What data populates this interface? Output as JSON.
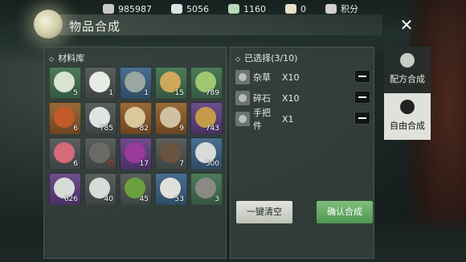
{
  "resources": [
    {
      "name": "currency-1",
      "value": "985987",
      "color": "#c9c9c9"
    },
    {
      "name": "currency-2",
      "value": "5056",
      "color": "#d8e4e8"
    },
    {
      "name": "currency-3",
      "value": "1160",
      "color": "#b8d8b8"
    },
    {
      "name": "currency-4",
      "value": "0",
      "color": "#e8e0c8"
    },
    {
      "name": "points",
      "value": "积分",
      "color": "#d0d0d0"
    }
  ],
  "header": {
    "title": "物品合成",
    "close": "✕"
  },
  "materials": {
    "title": "材料库",
    "items": [
      {
        "q": "green",
        "glyph": "#d8e4d0",
        "count": "5"
      },
      {
        "q": "gray",
        "glyph": "#e8ece6",
        "count": "1"
      },
      {
        "q": "blue",
        "glyph": "#9aa6a2",
        "count": "1"
      },
      {
        "q": "green",
        "glyph": "#d0a85a",
        "count": "15"
      },
      {
        "q": "green",
        "glyph": "#a0c870",
        "count": "789"
      },
      {
        "q": "orange",
        "glyph": "#c25a2a",
        "count": "6"
      },
      {
        "q": "gray",
        "glyph": "#e0e4e0",
        "count": "785"
      },
      {
        "q": "orange",
        "glyph": "#d8c89a",
        "count": "82"
      },
      {
        "q": "orange",
        "glyph": "#cfc2a2",
        "count": "9"
      },
      {
        "q": "purple",
        "glyph": "#c49a4a",
        "count": "743"
      },
      {
        "q": "gray",
        "glyph": "#d46a7a",
        "count": "6"
      },
      {
        "q": "gray",
        "glyph": "#6a6a66",
        "count": "0",
        "red": true
      },
      {
        "q": "purple",
        "glyph": "#9a3a9a",
        "count": "17"
      },
      {
        "q": "gray",
        "glyph": "#6a5440",
        "count": "7"
      },
      {
        "q": "blue",
        "glyph": "#d8dcd8",
        "count": "500"
      },
      {
        "q": "purple",
        "glyph": "#d8dcd8",
        "count": "626"
      },
      {
        "q": "gray",
        "glyph": "#d8dcd8",
        "count": "40"
      },
      {
        "q": "gray",
        "glyph": "#6aa040",
        "count": "45"
      },
      {
        "q": "blue",
        "glyph": "#e0e0dc",
        "count": "53"
      },
      {
        "q": "green",
        "glyph": "#8a8a84",
        "count": "3"
      }
    ]
  },
  "selected": {
    "title": "已选择(3/10)",
    "items": [
      {
        "name": "杂草",
        "qty": "X10"
      },
      {
        "name": "碎石",
        "qty": "X10"
      },
      {
        "name": "手把件",
        "qty": "X1"
      }
    ]
  },
  "buttons": {
    "clear": "一键清空",
    "confirm": "确认合成"
  },
  "tabs": {
    "recipe": "配方合成",
    "free": "自由合成"
  }
}
